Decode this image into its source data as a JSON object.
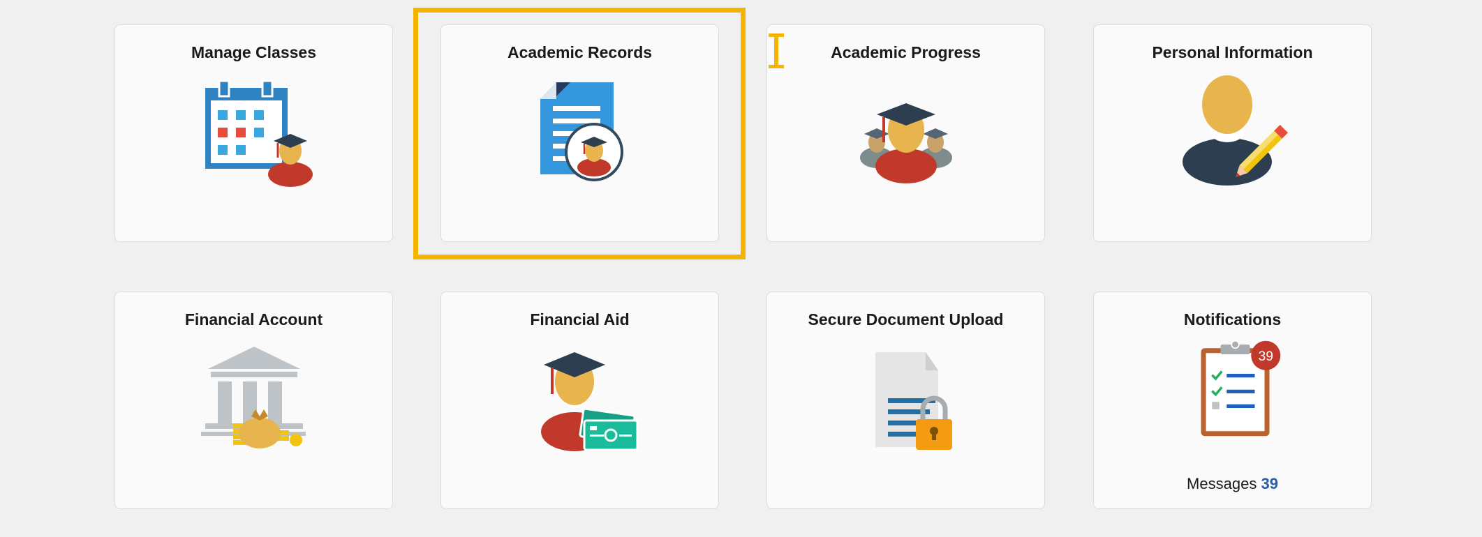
{
  "tiles": [
    {
      "title": "Manage Classes",
      "icon": "calendar-student-icon"
    },
    {
      "title": "Academic Records",
      "icon": "document-student-icon"
    },
    {
      "title": "Academic Progress",
      "icon": "graduates-icon"
    },
    {
      "title": "Personal Information",
      "icon": "person-pencil-icon"
    },
    {
      "title": "Financial Account",
      "icon": "bank-money-icon"
    },
    {
      "title": "Financial Aid",
      "icon": "graduate-cash-icon"
    },
    {
      "title": "Secure Document Upload",
      "icon": "document-lock-icon"
    },
    {
      "title": "Notifications",
      "icon": "clipboard-checklist-icon",
      "badge": "39",
      "messages_label": "Messages",
      "messages_count": "39"
    }
  ],
  "colors": {
    "background": "#f0f0f0",
    "tile": "#fafafa",
    "focus": "#f5b400",
    "link": "#2b5cab"
  }
}
